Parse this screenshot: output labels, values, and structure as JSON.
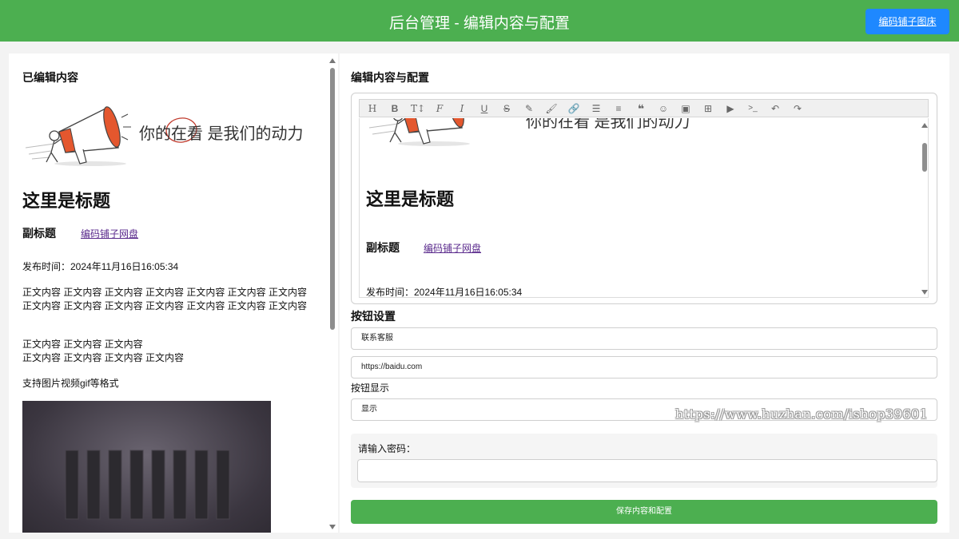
{
  "header": {
    "title": "后台管理 - 编辑内容与配置",
    "button_label": "编码铺子图床"
  },
  "preview": {
    "section_title": "已编辑内容",
    "banner_text": "你的在看 是我们的动力",
    "article_title": "这里是标题",
    "subtitle": "副标题",
    "subtitle_link": "编码铺子网盘",
    "publish_time": "发布时间：2024年11月16日16:05:34",
    "paragraph1": "正文内容  正文内容  正文内容  正文内容  正文内容  正文内容  正文内容  正文内容  正文内容  正文内容  正文内容  正文内容  正文内容  正文内容",
    "paragraph2_line1": "正文内容  正文内容  正文内容",
    "paragraph2_line2": "正文内容  正文内容  正文内容  正文内容",
    "formats_note": "支持图片视频gif等格式"
  },
  "editor": {
    "section_title": "编辑内容与配置",
    "toolbar": [
      "heading",
      "bold",
      "text-size",
      "font",
      "italic",
      "underline",
      "strikethrough",
      "highlight",
      "brush",
      "link",
      "list",
      "align",
      "quote",
      "emoji",
      "image",
      "table",
      "video",
      "code",
      "undo",
      "redo"
    ],
    "content": {
      "banner_text": "你的在看 是我们的动力",
      "article_title": "这里是标题",
      "subtitle": "副标题",
      "subtitle_link": "编码铺子网盘",
      "publish_time": "发布时间：2024年11月16日16:05:34"
    }
  },
  "button_settings": {
    "section_title": "按钮设置",
    "label_value": "联系客服",
    "url_value": "https://baidu.com",
    "display_label": "按钮显示",
    "display_selected": "显示"
  },
  "password": {
    "label": "请输入密码："
  },
  "save_label": "保存内容和配置",
  "watermark": "https://www.huzhan.com/ishop39601",
  "colors": {
    "header_green": "#4caf50",
    "button_blue": "#1e88ff",
    "link_purple": "#5a2a8c",
    "megaphone_orange": "#e4572e"
  }
}
